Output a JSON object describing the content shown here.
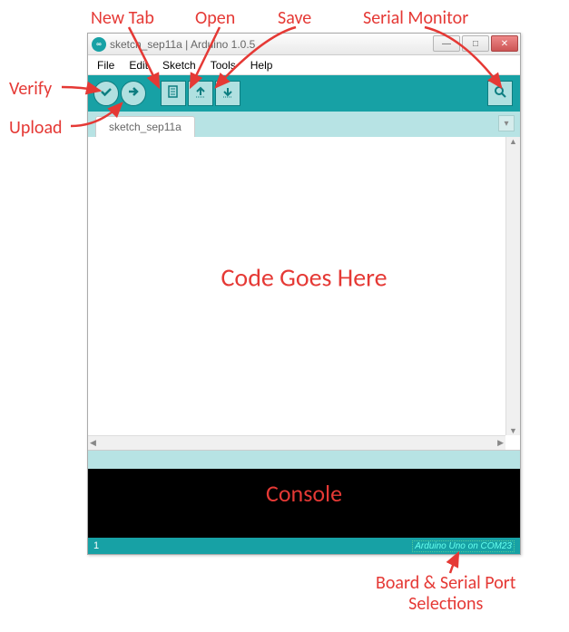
{
  "annotations": {
    "verify": "Verify",
    "upload": "Upload",
    "new_tab": "New Tab",
    "open": "Open",
    "save": "Save",
    "serial_monitor": "Serial Monitor",
    "code_goes_here": "Code Goes Here",
    "console": "Console",
    "board_port": "Board & Serial Port\nSelections"
  },
  "window": {
    "title": "sketch_sep11a | Arduino 1.0.5",
    "icon_text": "∞"
  },
  "menu": {
    "file": "File",
    "edit": "Edit",
    "sketch": "Sketch",
    "tools": "Tools",
    "help": "Help"
  },
  "tab": {
    "name": "sketch_sep11a"
  },
  "footer": {
    "line": "1",
    "board": "Arduino Uno on COM23"
  }
}
